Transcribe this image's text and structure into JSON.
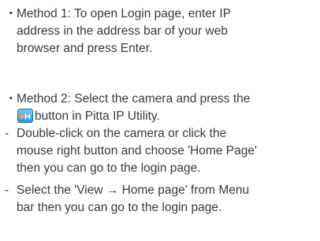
{
  "method1": {
    "bullet": "・",
    "lines": [
      "Method 1: To open Login page, enter IP",
      "address in the address bar of your web",
      "browser and press Enter."
    ]
  },
  "method2": {
    "bullet": "・",
    "line1": "Method 2: Select the camera and press the",
    "line2_after_icon": "button in Pitta IP Utility.",
    "icon": {
      "name": "home-page-h-icon",
      "glyph": "H",
      "colors": {
        "background": "#2a8fd8",
        "highlight": "#7cc8ff",
        "accent": "#f2a23a",
        "glyph": "#ffffff"
      }
    }
  },
  "option_double_click": {
    "dash": "-",
    "lines": [
      "Double-click on the camera or click the",
      "mouse right button and choose 'Home Page'",
      "then you can go to the login page."
    ]
  },
  "option_view_menu": {
    "dash": "-",
    "lines": [
      "Select the 'View → Home page' from Menu",
      "bar then you can go to the login page."
    ]
  }
}
